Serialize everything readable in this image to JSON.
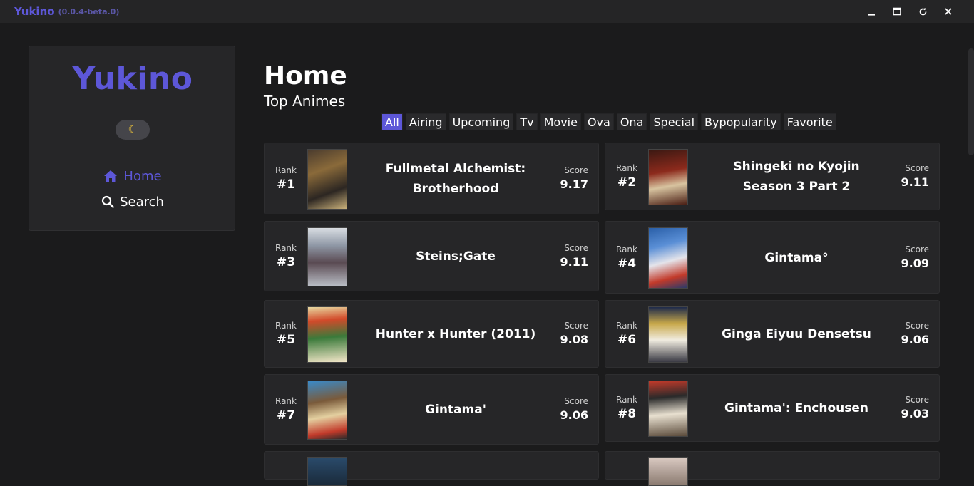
{
  "window": {
    "app_name": "Yukino",
    "version": "(0.0.4-beta.0)"
  },
  "sidebar": {
    "brand": "Yukino",
    "theme_toggle_icon": "moon-icon",
    "nav": [
      {
        "label": "Home",
        "icon": "home-icon",
        "active": true
      },
      {
        "label": "Search",
        "icon": "search-icon",
        "active": false
      }
    ]
  },
  "main": {
    "title": "Home",
    "subtitle": "Top Animes",
    "tabs": [
      "All",
      "Airing",
      "Upcoming",
      "Tv",
      "Movie",
      "Ova",
      "Ona",
      "Special",
      "Bypopularity",
      "Favorite"
    ],
    "active_tab": "All",
    "rank_label": "Rank",
    "score_label": "Score",
    "animes": [
      {
        "rank": "#1",
        "title": "Fullmetal Alchemist: Brotherhood",
        "score": "9.17"
      },
      {
        "rank": "#2",
        "title": "Shingeki no Kyojin Season 3 Part 2",
        "score": "9.11"
      },
      {
        "rank": "#3",
        "title": "Steins;Gate",
        "score": "9.11"
      },
      {
        "rank": "#4",
        "title": "Gintama°",
        "score": "9.09"
      },
      {
        "rank": "#5",
        "title": "Hunter x Hunter (2011)",
        "score": "9.08"
      },
      {
        "rank": "#6",
        "title": "Ginga Eiyuu Densetsu",
        "score": "9.06"
      },
      {
        "rank": "#7",
        "title": "Gintama'",
        "score": "9.06"
      },
      {
        "rank": "#8",
        "title": "Gintama': Enchousen",
        "score": "9.03"
      }
    ]
  },
  "colors": {
    "accent": "#5d57d8",
    "background": "#1b1b1c",
    "card": "#262628"
  }
}
